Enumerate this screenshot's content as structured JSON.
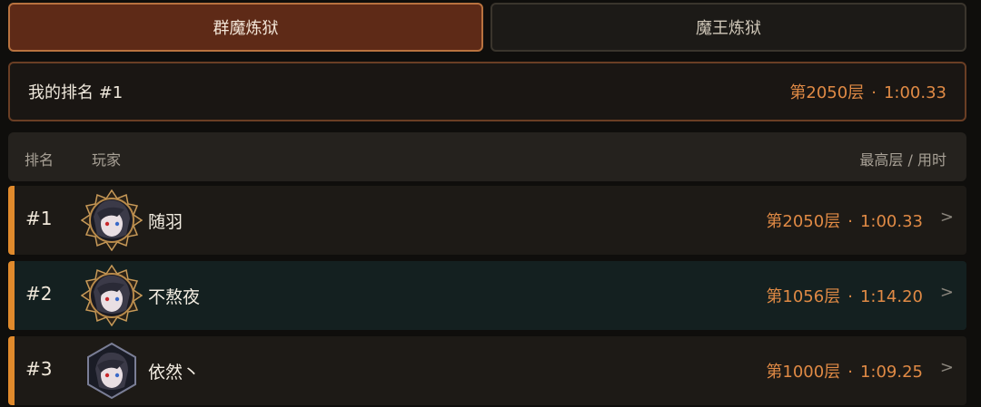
{
  "tabs": [
    {
      "label": "群魔炼狱",
      "active": true
    },
    {
      "label": "魔王炼狱",
      "active": false
    }
  ],
  "my_rank": {
    "label": "我的排名 #1",
    "floor": "第2050层",
    "sep": "·",
    "time": "1:00.33"
  },
  "table_header": {
    "rank": "排名",
    "player": "玩家",
    "best": "最高层 / 用时"
  },
  "rows": [
    {
      "rank": "#1",
      "name": "随羽",
      "floor": "第2050层",
      "sep": "·",
      "time": "1:00.33",
      "chevron": ">"
    },
    {
      "rank": "#2",
      "name": "不熬夜",
      "floor": "第1056层",
      "sep": "·",
      "time": "1:14.20",
      "chevron": ">"
    },
    {
      "rank": "#3",
      "name": "依然丶",
      "floor": "第1000层",
      "sep": "·",
      "time": "1:09.25",
      "chevron": ">"
    }
  ],
  "colors": {
    "accent": "#e08a45",
    "tab_active_bg": "#5e2a17",
    "row_bar": "#e08a2c",
    "row1_bg": "#1d1a16",
    "row2_bg": "#142020",
    "row3_bg": "#1d1a16"
  }
}
